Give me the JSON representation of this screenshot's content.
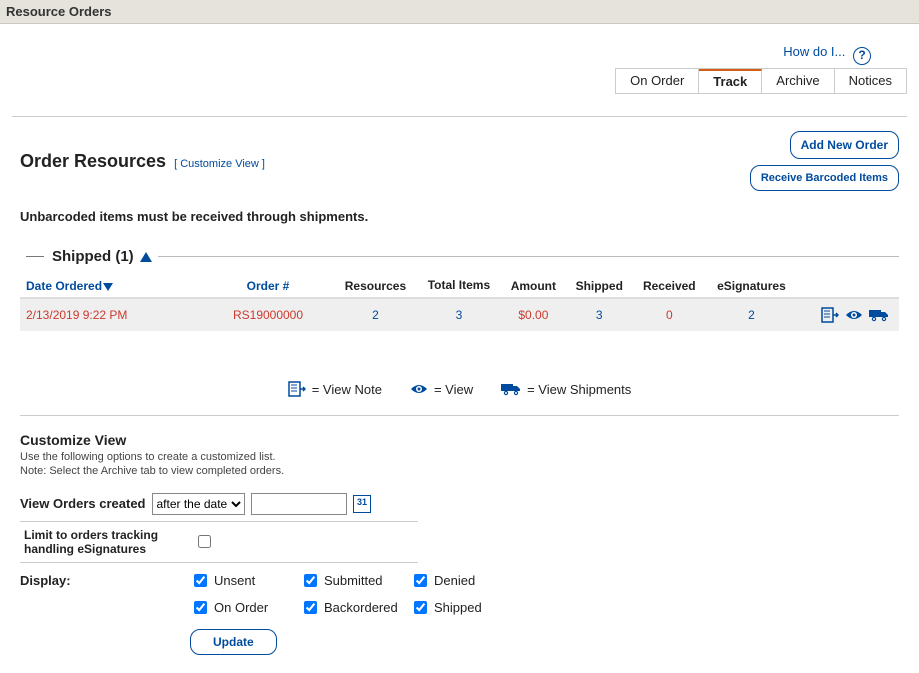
{
  "header": {
    "title": "Resource Orders"
  },
  "help": {
    "label": "How do I..."
  },
  "tabs": [
    {
      "label": "On Order"
    },
    {
      "label": "Track"
    },
    {
      "label": "Archive"
    },
    {
      "label": "Notices"
    }
  ],
  "page_title": "Order Resources",
  "customize_link": "[ Customize View ]",
  "buttons": {
    "add_new_order": "Add New Order",
    "receive_barcoded": "Receive Barcoded Items",
    "update": "Update"
  },
  "notice": "Unbarcoded items must be received through shipments.",
  "section": {
    "title": "Shipped (1)"
  },
  "columns": {
    "date_ordered": "Date Ordered",
    "order_no": "Order #",
    "resources": "Resources",
    "total_items": "Total Items",
    "amount": "Amount",
    "shipped": "Shipped",
    "received": "Received",
    "esignatures": "eSignatures"
  },
  "rows": [
    {
      "date_ordered": "2/13/2019 9:22 PM",
      "order_no": "RS19000000",
      "resources": "2",
      "total_items": "3",
      "amount": "$0.00",
      "shipped": "3",
      "received": "0",
      "esignatures": "2"
    }
  ],
  "legend": {
    "view_note": "= View Note",
    "view": "= View",
    "view_shipments": "= View Shipments"
  },
  "customize": {
    "title": "Customize View",
    "sub1": "Use the following options to create a customized list.",
    "sub2": "Note: Select the Archive tab to view completed orders.",
    "view_orders_created": "View Orders created",
    "date_mode": "after the date",
    "limit_esig": "Limit to orders tracking handling eSignatures",
    "display": "Display:",
    "opts": {
      "unsent": "Unsent",
      "submitted": "Submitted",
      "denied": "Denied",
      "on_order": "On Order",
      "backordered": "Backordered",
      "shipped": "Shipped"
    }
  }
}
